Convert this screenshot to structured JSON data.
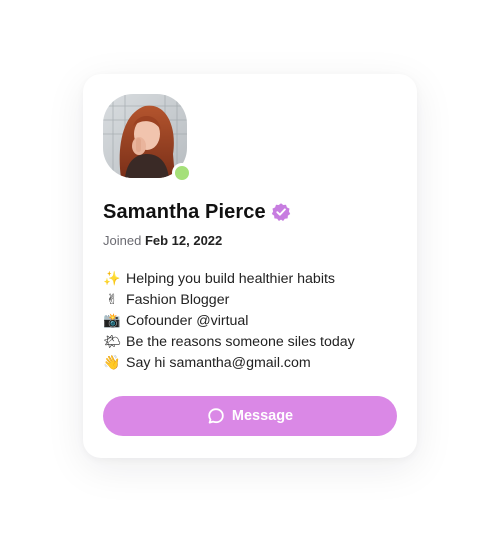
{
  "profile": {
    "name": "Samantha Pierce",
    "verified_icon": "verified-badge-icon",
    "joined_label": "Joined",
    "joined_date": "Feb 12, 2022",
    "status": "online"
  },
  "bio": [
    {
      "emoji": "✨",
      "text": "Helping you build healthier habits"
    },
    {
      "emoji": "✌",
      "text": "Fashion Blogger"
    },
    {
      "emoji": "📸",
      "text": "Cofounder @virtual"
    },
    {
      "emoji": "🌤",
      "text": "Be the reasons someone siles today"
    },
    {
      "emoji": "👋",
      "text": "Say hi samantha@gmail.com"
    }
  ],
  "actions": {
    "message_label": "Message",
    "message_icon": "message-circle-icon"
  },
  "colors": {
    "accent": "#da88e6",
    "verified": "#c77de0",
    "online": "#a5e079"
  }
}
